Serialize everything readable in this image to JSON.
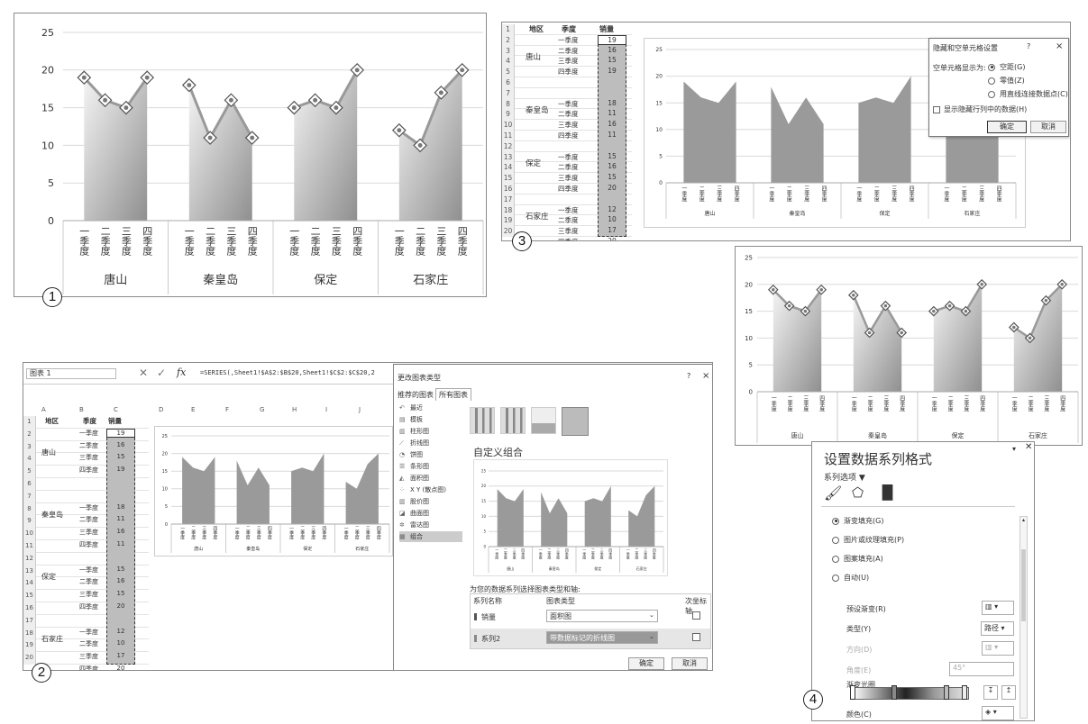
{
  "callouts": [
    "1",
    "2",
    "3",
    "4"
  ],
  "chart_data": {
    "type": "area",
    "title": "",
    "groups": [
      "唐山",
      "秦皇岛",
      "保定",
      "石家庄"
    ],
    "categories": [
      "一季度",
      "二季度",
      "三季度",
      "四季度"
    ],
    "series": [
      {
        "name": "销量",
        "values": [
          [
            19,
            16,
            15,
            19
          ],
          [
            18,
            11,
            16,
            11
          ],
          [
            15,
            16,
            15,
            20
          ],
          [
            12,
            10,
            17,
            20
          ]
        ]
      }
    ],
    "ylim": [
      0,
      25
    ],
    "yticks": [
      "0",
      "5",
      "10",
      "15",
      "20",
      "25"
    ],
    "grid": true
  },
  "sheet": {
    "col_headers": [
      "地区",
      "季度",
      "销量"
    ],
    "regions": [
      "唐山",
      "秦皇岛",
      "保定",
      "石家庄"
    ],
    "quarters": [
      "一季度",
      "二季度",
      "三季度",
      "四季度"
    ],
    "row_numbers": [
      "1",
      "2",
      "3",
      "4",
      "5",
      "6",
      "7",
      "8",
      "9",
      "10",
      "11",
      "12",
      "13",
      "14",
      "15",
      "16",
      "17",
      "18",
      "19",
      "20"
    ]
  },
  "hidden_cells_dialog": {
    "title": "隐藏和空单元格设置",
    "help": "?",
    "close": "×",
    "show_empty_label": "空单元格显示为:",
    "options": [
      "空距(G)",
      "零值(Z)",
      "用直线连接数据点(C)"
    ],
    "show_hidden_label": "显示隐藏行列中的数据(H)",
    "ok": "确定",
    "cancel": "取消"
  },
  "excel_bar": {
    "name_box": "图表 1",
    "fx": "fx",
    "formula": "=SERIES(,Sheet1!$A$2:$B$20,Sheet1!$C$2:$C$20,2",
    "col_letters": [
      "A",
      "B",
      "C",
      "D",
      "E",
      "F",
      "G",
      "H",
      "I",
      "J"
    ]
  },
  "change_type_dialog": {
    "title": "更改图表类型",
    "help": "?",
    "close": "×",
    "tabs": [
      "推荐的图表",
      "所有图表"
    ],
    "types": [
      "最近",
      "模板",
      "柱形图",
      "折线图",
      "饼图",
      "条形图",
      "面积图",
      "X Y (散点图)",
      "股价图",
      "曲面图",
      "雷达图",
      "组合"
    ],
    "combo_title": "自定义组合",
    "series_prompt": "为您的数据系列选择图表类型和轴:",
    "headers": [
      "系列名称",
      "图表类型",
      "次坐标轴"
    ],
    "rows": [
      {
        "name": "销量",
        "type": "面积图"
      },
      {
        "name": "系列2",
        "type": "带数据标记的折线图"
      }
    ],
    "ok": "确定",
    "cancel": "取消"
  },
  "format_panel": {
    "title": "设置数据系列格式",
    "section": "系列选项 ▼",
    "fill_options": [
      "渐变填充(G)",
      "图片或纹理填充(P)",
      "图案填充(A)",
      "自动(U)"
    ],
    "preset_label": "预设渐变(R)",
    "type_label": "类型(Y)",
    "type_value": "路径",
    "direction_label": "方向(D)",
    "angle_label": "角度(E)",
    "angle_value": "45°",
    "stops_label": "渐变光圈",
    "color_label": "颜色(C)"
  },
  "colors": {
    "area_light": "#f4f4f4",
    "area_dark": "#8f8f8f",
    "area_flat": "#9a9a9a",
    "line": "#999999",
    "grid": "#d9d9d9",
    "highlight": "#bdbdbd"
  }
}
